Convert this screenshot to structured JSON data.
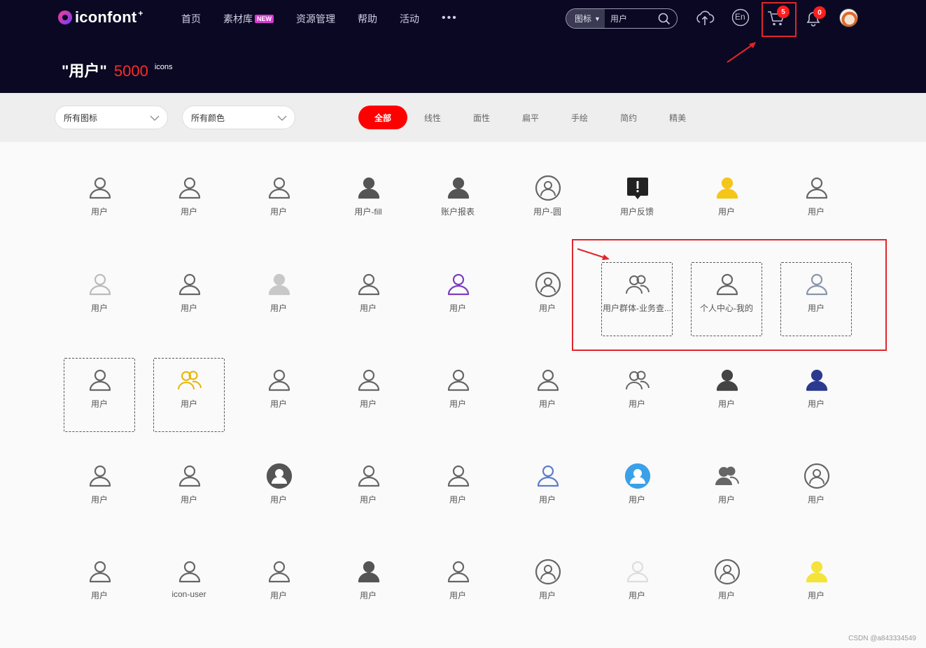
{
  "brand": {
    "name": "iconfont",
    "plus": "+"
  },
  "nav": [
    {
      "label": "首页"
    },
    {
      "label": "素材库",
      "badge": "NEW"
    },
    {
      "label": "资源管理"
    },
    {
      "label": "帮助"
    },
    {
      "label": "活动"
    }
  ],
  "nav_more": "•••",
  "search": {
    "type": "图标",
    "value": "用户"
  },
  "header_icons": {
    "lang": "En",
    "cart_count": "5",
    "bell_count": "0"
  },
  "result": {
    "query": "\"用户\"",
    "count": "5000",
    "unit": "icons"
  },
  "filters": {
    "type": "所有图标",
    "color": "所有颜色",
    "tabs": [
      "全部",
      "线性",
      "面性",
      "扁平",
      "手绘",
      "简约",
      "精美"
    ],
    "active_tab": "全部"
  },
  "icons": [
    [
      "用户",
      "用户",
      "用户",
      "用户-fill",
      "账户报表",
      "用户-圆",
      "用户反馈",
      "用户",
      "用户"
    ],
    [
      "用户",
      "用户",
      "用户",
      "用户",
      "用户",
      "用户",
      "用户群体-业务查...",
      "个人中心-我的",
      "用户"
    ],
    [
      "用户",
      "用户",
      "用户",
      "用户",
      "用户",
      "用户",
      "用户",
      "用户",
      "用户"
    ],
    [
      "用户",
      "用户",
      "用户",
      "用户",
      "用户",
      "用户",
      "用户",
      "用户",
      "用户"
    ],
    [
      "用户",
      "icon-user",
      "用户",
      "用户",
      "用户",
      "用户",
      "用户",
      "用户",
      "用户"
    ]
  ],
  "watermark": "CSDN @a843334549"
}
